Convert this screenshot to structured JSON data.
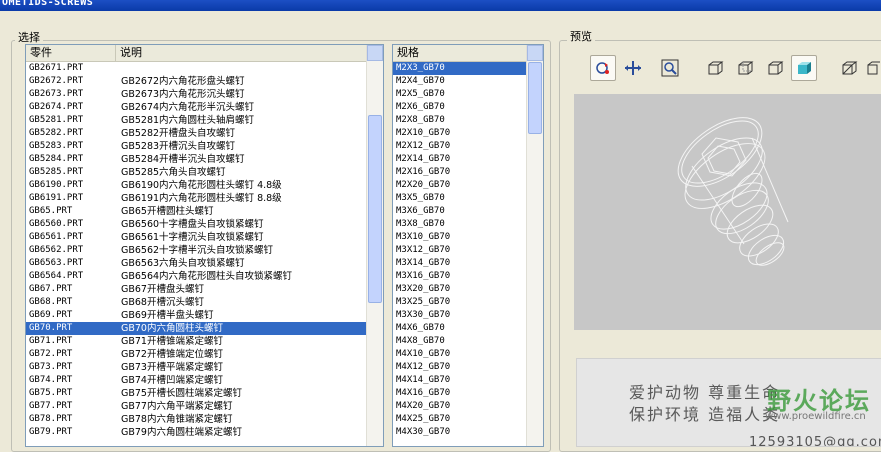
{
  "window": {
    "title": "OMETIDS-SCREWS"
  },
  "select_group": {
    "title": "选择"
  },
  "preview_group": {
    "title": "预览"
  },
  "parts_table": {
    "columns": [
      "零件",
      "说明"
    ],
    "rows": [
      {
        "part": "GB2671.PRT",
        "desc": ""
      },
      {
        "part": "GB2672.PRT",
        "desc": "GB2672内六角花形盘头螺钉"
      },
      {
        "part": "GB2673.PRT",
        "desc": "GB2673内六角花形沉头螺钉"
      },
      {
        "part": "GB2674.PRT",
        "desc": "GB2674内六角花形半沉头螺钉"
      },
      {
        "part": "GB5281.PRT",
        "desc": "GB5281内六角圆柱头轴肩螺钉"
      },
      {
        "part": "GB5282.PRT",
        "desc": "GB5282开槽盘头自攻螺钉"
      },
      {
        "part": "GB5283.PRT",
        "desc": "GB5283开槽沉头自攻螺钉"
      },
      {
        "part": "GB5284.PRT",
        "desc": "GB5284开槽半沉头自攻螺钉"
      },
      {
        "part": "GB5285.PRT",
        "desc": "GB5285六角头自攻螺钉"
      },
      {
        "part": "GB6190.PRT",
        "desc": "GB6190内六角花形圆柱头螺钉  4.8级"
      },
      {
        "part": "GB6191.PRT",
        "desc": "GB6191内六角花形圆柱头螺钉  8.8级"
      },
      {
        "part": "GB65.PRT",
        "desc": "GB65开槽圆柱头螺钉"
      },
      {
        "part": "GB6560.PRT",
        "desc": "GB6560十字槽盘头自攻锁紧螺钉"
      },
      {
        "part": "GB6561.PRT",
        "desc": "GB6561十字槽沉头自攻锁紧螺钉"
      },
      {
        "part": "GB6562.PRT",
        "desc": "GB6562十字槽半沉头自攻锁紧螺钉"
      },
      {
        "part": "GB6563.PRT",
        "desc": "GB6563六角头自攻锁紧螺钉"
      },
      {
        "part": "GB6564.PRT",
        "desc": "GB6564内六角花形圆柱头自攻锁紧螺钉"
      },
      {
        "part": "GB67.PRT",
        "desc": "GB67开槽盘头螺钉"
      },
      {
        "part": "GB68.PRT",
        "desc": "GB68开槽沉头螺钉"
      },
      {
        "part": "GB69.PRT",
        "desc": "GB69开槽半盘头螺钉"
      },
      {
        "part": "GB70.PRT",
        "desc": "GB70内六角圆柱头螺钉"
      },
      {
        "part": "GB71.PRT",
        "desc": "GB71开槽锥端紧定螺钉"
      },
      {
        "part": "GB72.PRT",
        "desc": "GB72开槽锥端定位螺钉"
      },
      {
        "part": "GB73.PRT",
        "desc": "GB73开槽平端紧定螺钉"
      },
      {
        "part": "GB74.PRT",
        "desc": "GB74开槽凹端紧定螺钉"
      },
      {
        "part": "GB75.PRT",
        "desc": "GB75开槽长圆柱端紧定螺钉"
      },
      {
        "part": "GB77.PRT",
        "desc": "GB77内六角平端紧定螺钉"
      },
      {
        "part": "GB78.PRT",
        "desc": "GB78内六角锥端紧定螺钉"
      },
      {
        "part": "GB79.PRT",
        "desc": "GB79内六角圆柱端紧定螺钉"
      }
    ],
    "selected_index": 20
  },
  "spec_list": {
    "header": "规格",
    "items": [
      "M2X3_GB70",
      "M2X4_GB70",
      "M2X5_GB70",
      "M2X6_GB70",
      "M2X8_GB70",
      "M2X10_GB70",
      "M2X12_GB70",
      "M2X14_GB70",
      "M2X16_GB70",
      "M2X20_GB70",
      "M3X5_GB70",
      "M3X6_GB70",
      "M3X8_GB70",
      "M3X10_GB70",
      "M3X12_GB70",
      "M3X14_GB70",
      "M3X16_GB70",
      "M3X20_GB70",
      "M3X25_GB70",
      "M3X30_GB70",
      "M4X6_GB70",
      "M4X8_GB70",
      "M4X10_GB70",
      "M4X12_GB70",
      "M4X14_GB70",
      "M4X16_GB70",
      "M4X20_GB70",
      "M4X25_GB70",
      "M4X30_GB70"
    ],
    "selected_index": 0
  },
  "watermark": {
    "line1": "爱护动物  尊重生命",
    "line2": "保护环境  造福人类",
    "site": "www.proewildfire.cn",
    "logo": "野火论坛",
    "partial_number": "12593105@qq.com"
  },
  "colors": {
    "selection": "#316ac5",
    "preview_bg": "#c7c7c7",
    "dialog_bg": "#ece9d8"
  }
}
